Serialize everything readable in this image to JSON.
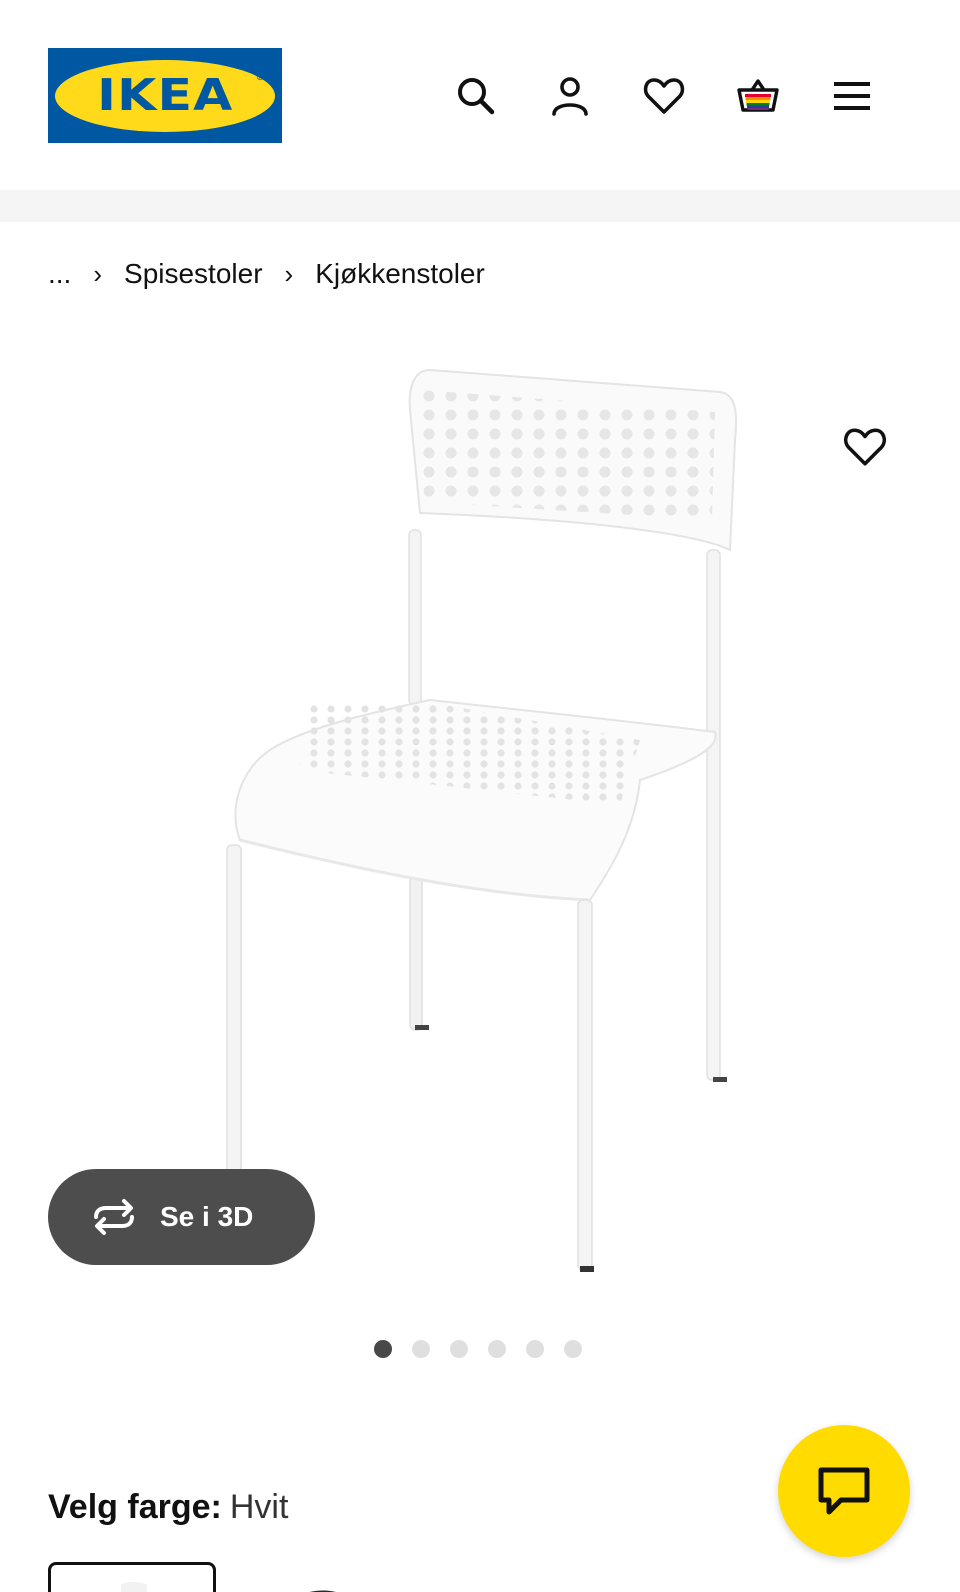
{
  "brand": {
    "logo_text": "IKEA",
    "logo_mark": "®",
    "colors": {
      "blue": "#0058a3",
      "yellow": "#ffda1a"
    }
  },
  "header": {
    "icons": [
      "search-icon",
      "account-icon",
      "favourites-icon",
      "shopping-bag-icon",
      "menu-icon"
    ]
  },
  "breadcrumb": {
    "ellipsis": "...",
    "separator": "›",
    "items": [
      "Spisestoler",
      "Kjøkkenstoler"
    ]
  },
  "product": {
    "image_alt": "chair",
    "view_3d_label": "Se i 3D",
    "gallery_count": 6,
    "gallery_active_index": 0
  },
  "color_selector": {
    "label": "Velg farge:",
    "value": "Hvit"
  },
  "chat": {
    "icon": "chat-icon",
    "color": "#ffdb00"
  }
}
